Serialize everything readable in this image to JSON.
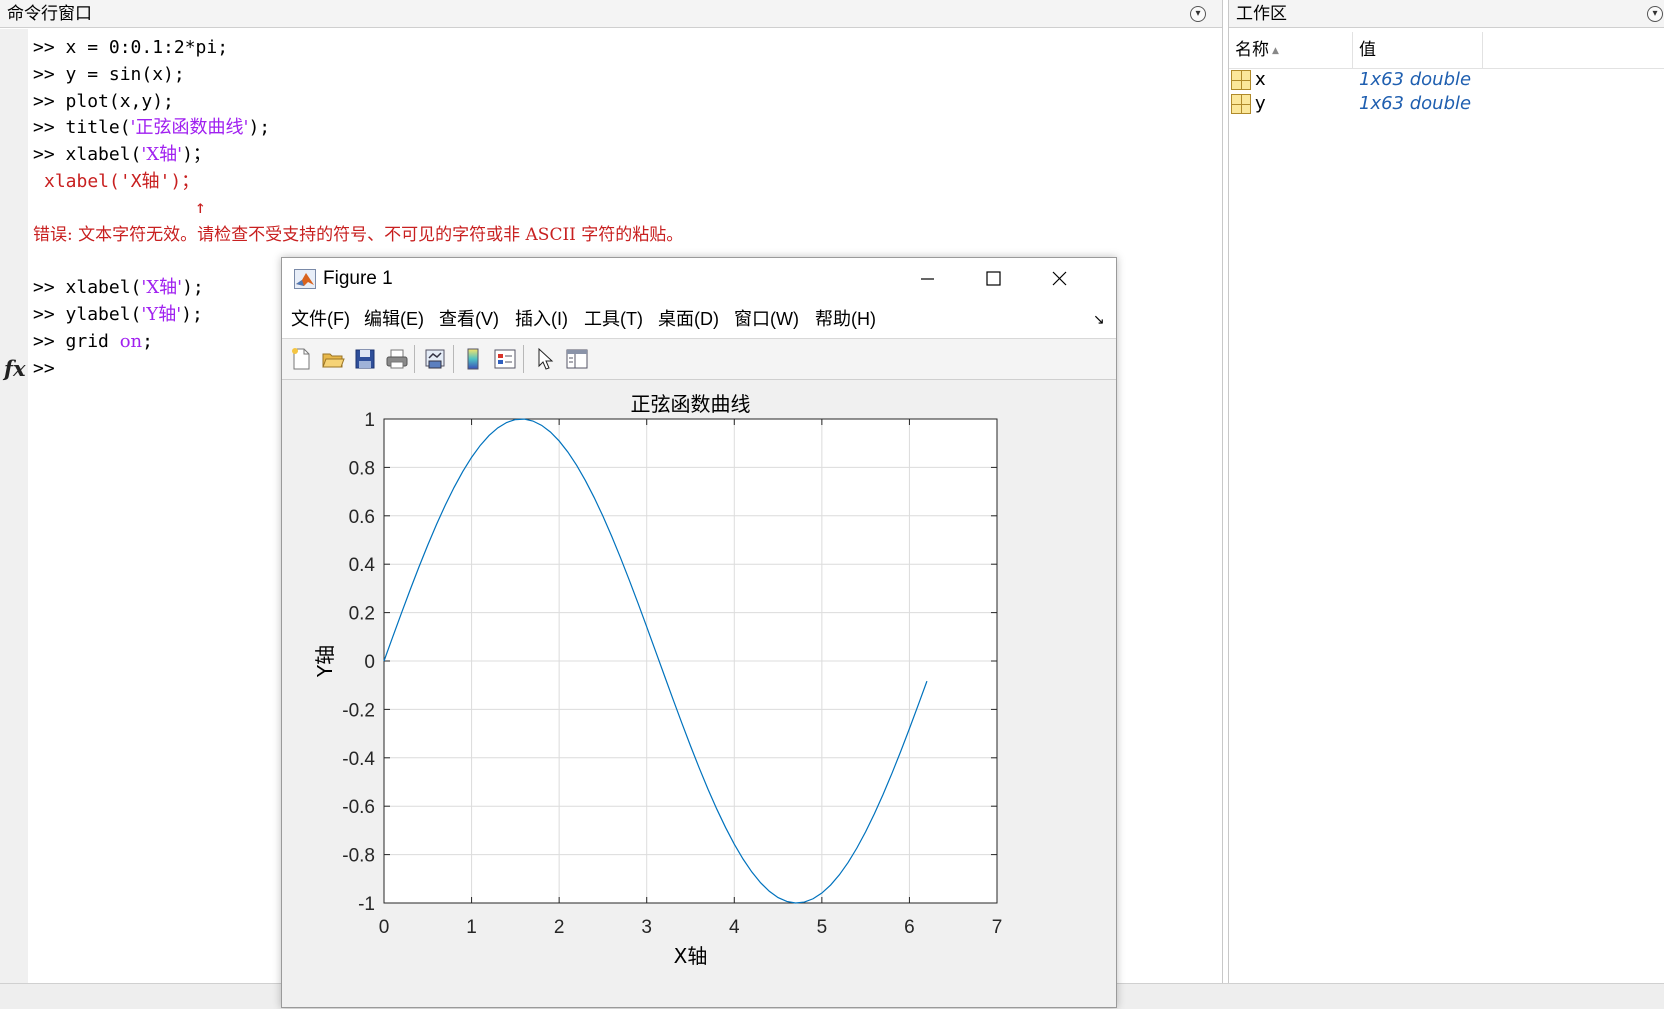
{
  "command_window": {
    "title": "命令行窗口",
    "lines": [
      {
        "prompt": ">> ",
        "code": "x = 0:0.1:2*pi;"
      },
      {
        "prompt": ">> ",
        "code": "y = sin(x);"
      },
      {
        "prompt": ">> ",
        "code": "plot(x,y);"
      },
      {
        "prompt": ">> ",
        "code_before": "title(",
        "string": "'正弦函数曲线'",
        "code_after": ");"
      },
      {
        "prompt": ">> ",
        "code_before": "xlabel(",
        "string": "'X轴'",
        "code_after": ")；"
      }
    ],
    "error_echo": "xlabel('X轴')；",
    "error_caret": "↑",
    "error_message": "错误: 文本字符无效。请检查不受支持的符号、不可见的字符或非 ASCII 字符的粘贴。",
    "lines_after": [
      {
        "prompt": ">> ",
        "code_before": "xlabel(",
        "string": "'X轴'",
        "code_after": ");"
      },
      {
        "prompt": ">> ",
        "code_before": "ylabel(",
        "string": "'Y轴'",
        "code_after": ");"
      },
      {
        "prompt": ">> ",
        "code_before": "grid ",
        "string": "on",
        "code_after": ";"
      }
    ],
    "current_prompt": ">>",
    "fx_label": "fx"
  },
  "workspace": {
    "title": "工作区",
    "columns": [
      "名称",
      "值"
    ],
    "variables": [
      {
        "name": "x",
        "value": "1x63 double"
      },
      {
        "name": "y",
        "value": "1x63 double"
      }
    ]
  },
  "figure": {
    "title": "Figure 1",
    "menu": [
      "文件(F)",
      "编辑(E)",
      "查看(V)",
      "插入(I)",
      "工具(T)",
      "桌面(D)",
      "窗口(W)",
      "帮助(H)"
    ],
    "toolbar_icons": [
      "new-figure-icon",
      "open-file-icon",
      "save-icon",
      "print-icon",
      "link-plot-icon",
      "colorbar-icon",
      "legend-icon",
      "pointer-icon",
      "property-editor-icon"
    ]
  },
  "chart_data": {
    "type": "line",
    "title": "正弦函数曲线",
    "xlabel": "X轴",
    "ylabel": "Y轴",
    "xlim": [
      0,
      7
    ],
    "ylim": [
      -1,
      1
    ],
    "xticks": [
      "0",
      "1",
      "2",
      "3",
      "4",
      "5",
      "6",
      "7"
    ],
    "yticks": [
      "1",
      "0.8",
      "0.6",
      "0.4",
      "0.2",
      "0",
      "-0.2",
      "-0.4",
      "-0.6",
      "-0.8",
      "-1"
    ],
    "grid": true,
    "line_color": "#0072bd",
    "series": [
      {
        "function": "sin(x)",
        "x_start": 0,
        "x_step": 0.1,
        "x_end": 6.2
      }
    ]
  }
}
